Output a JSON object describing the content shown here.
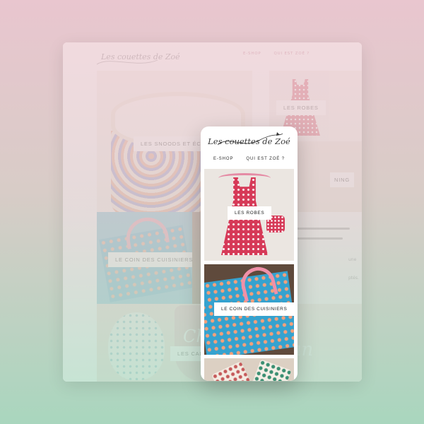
{
  "brand": {
    "logo_text": "Les couettes de Zoé"
  },
  "desktop": {
    "nav": [
      "E-SHOP",
      "QUI EST ZOÉ ?"
    ],
    "tiles": {
      "snoods": "LES SNOODS ET ÉCHARPES",
      "robes": "LES ROBES",
      "right_partial": "NING",
      "cuisine": "LE COIN DES CUISINIERS",
      "cadeaux": "LES CADEAUX",
      "cup_word": "Che",
      "cup_word2": "an"
    },
    "text_partial": [
      "une",
      "ptés."
    ]
  },
  "phone": {
    "nav": [
      "E-SHOP",
      "QUI EST ZOÉ ?"
    ],
    "tiles": {
      "robes": "LES ROBES",
      "cuisine": "LE COIN DES CUISINIERS"
    }
  },
  "colors": {
    "accent_pink": "#b26076",
    "background_top": "#e9c6cf",
    "background_bottom": "#a9d6be"
  }
}
